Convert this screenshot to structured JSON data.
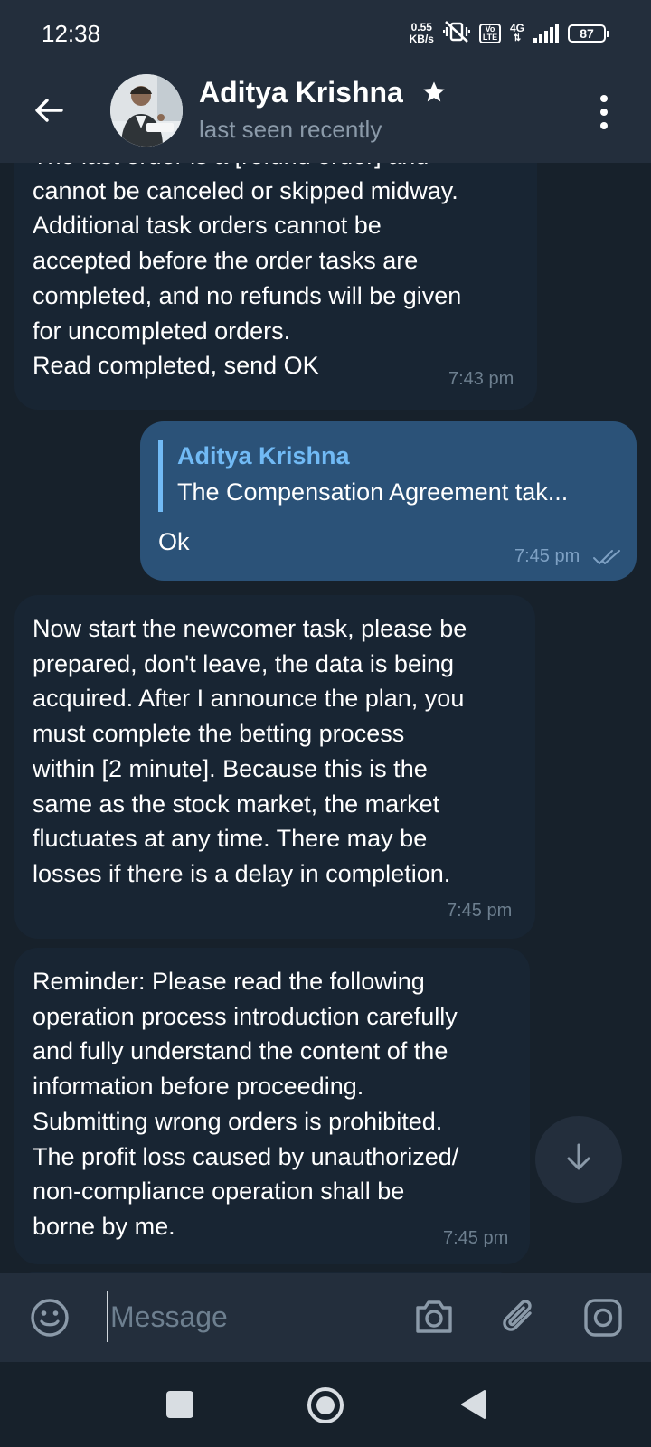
{
  "status_bar": {
    "time": "12:38",
    "net_speed_value": "0.55",
    "net_speed_unit": "KB/s",
    "volte_top": "Vo",
    "volte_bottom": "LTE",
    "network_type": "4G",
    "battery_level": "87",
    "icons": [
      "vibrate-off-icon",
      "volte-icon",
      "signal-icon",
      "battery-icon"
    ]
  },
  "header": {
    "contact_name": "Aditya Krishna",
    "contact_status": "last seen recently",
    "icons": [
      "back-arrow-icon",
      "star-icon",
      "more-vert-icon"
    ]
  },
  "messages": [
    {
      "direction": "incoming",
      "text": "The last order is a [refund order] and\ncannot be canceled or skipped midway.\nAdditional task orders cannot be\naccepted before the order tasks are\ncompleted, and no refunds will be given\nfor uncompleted orders.\nRead completed, send OK",
      "time": "7:43 pm"
    },
    {
      "direction": "outgoing",
      "reply_author": "Aditya Krishna",
      "reply_text": "The Compensation Agreement tak...",
      "text": "Ok",
      "time": "7:45 pm",
      "status": "read"
    },
    {
      "direction": "incoming",
      "text": "Now start the newcomer task, please be\nprepared, don't leave, the data is being\nacquired. After I announce the plan, you\nmust complete the betting process\nwithin [2 minute]. Because this is the\nsame as the stock market, the market\nfluctuates at any time. There may be\nlosses if there is a delay in completion.",
      "time": "7:45 pm"
    },
    {
      "direction": "incoming",
      "text": "Reminder: Please read the following\noperation process introduction carefully\nand fully understand the content of the\ninformation before proceeding.\nSubmitting wrong orders is prohibited.\nThe profit loss caused by unauthorized/\nnon-compliance operation shall be\nborne by me.",
      "time": "7:45 pm"
    }
  ],
  "composer": {
    "placeholder": "Message",
    "icons": [
      "emoji-icon",
      "camera-icon",
      "attach-icon",
      "instagram-icon"
    ]
  },
  "nav_bar": {
    "icons": [
      "recents-icon",
      "home-icon",
      "back-icon"
    ]
  },
  "colors": {
    "background": "#17212b",
    "bar": "#232e3c",
    "incoming_bubble": "#182533",
    "outgoing_bubble": "#2b5278",
    "accent": "#71baf5"
  }
}
